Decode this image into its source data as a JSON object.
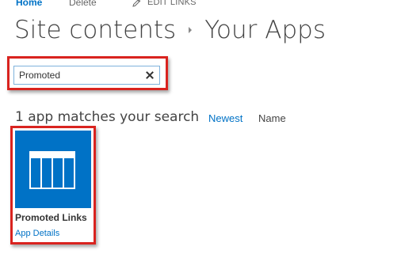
{
  "topnav": {
    "home_label": "Home",
    "delete_label": "Delete",
    "edit_links_label": "EDIT LINKS",
    "edit_icon": "pencil-icon"
  },
  "header": {
    "breadcrumb_root": "Site contents",
    "breadcrumb_separator_icon": "chevron-right-icon",
    "breadcrumb_current": "Your Apps"
  },
  "search": {
    "value": "Promoted",
    "clear_icon": "close-icon"
  },
  "results": {
    "count_text": "1 app matches your search",
    "sort_newest_label": "Newest",
    "sort_name_label": "Name"
  },
  "apps": [
    {
      "name": "Promoted Links",
      "details_label": "App Details",
      "icon": "promoted-links-icon",
      "tile_color": "#0072c6"
    }
  ],
  "colors": {
    "accent": "#0072c6",
    "highlight": "#d9231f",
    "text": "#444444"
  }
}
